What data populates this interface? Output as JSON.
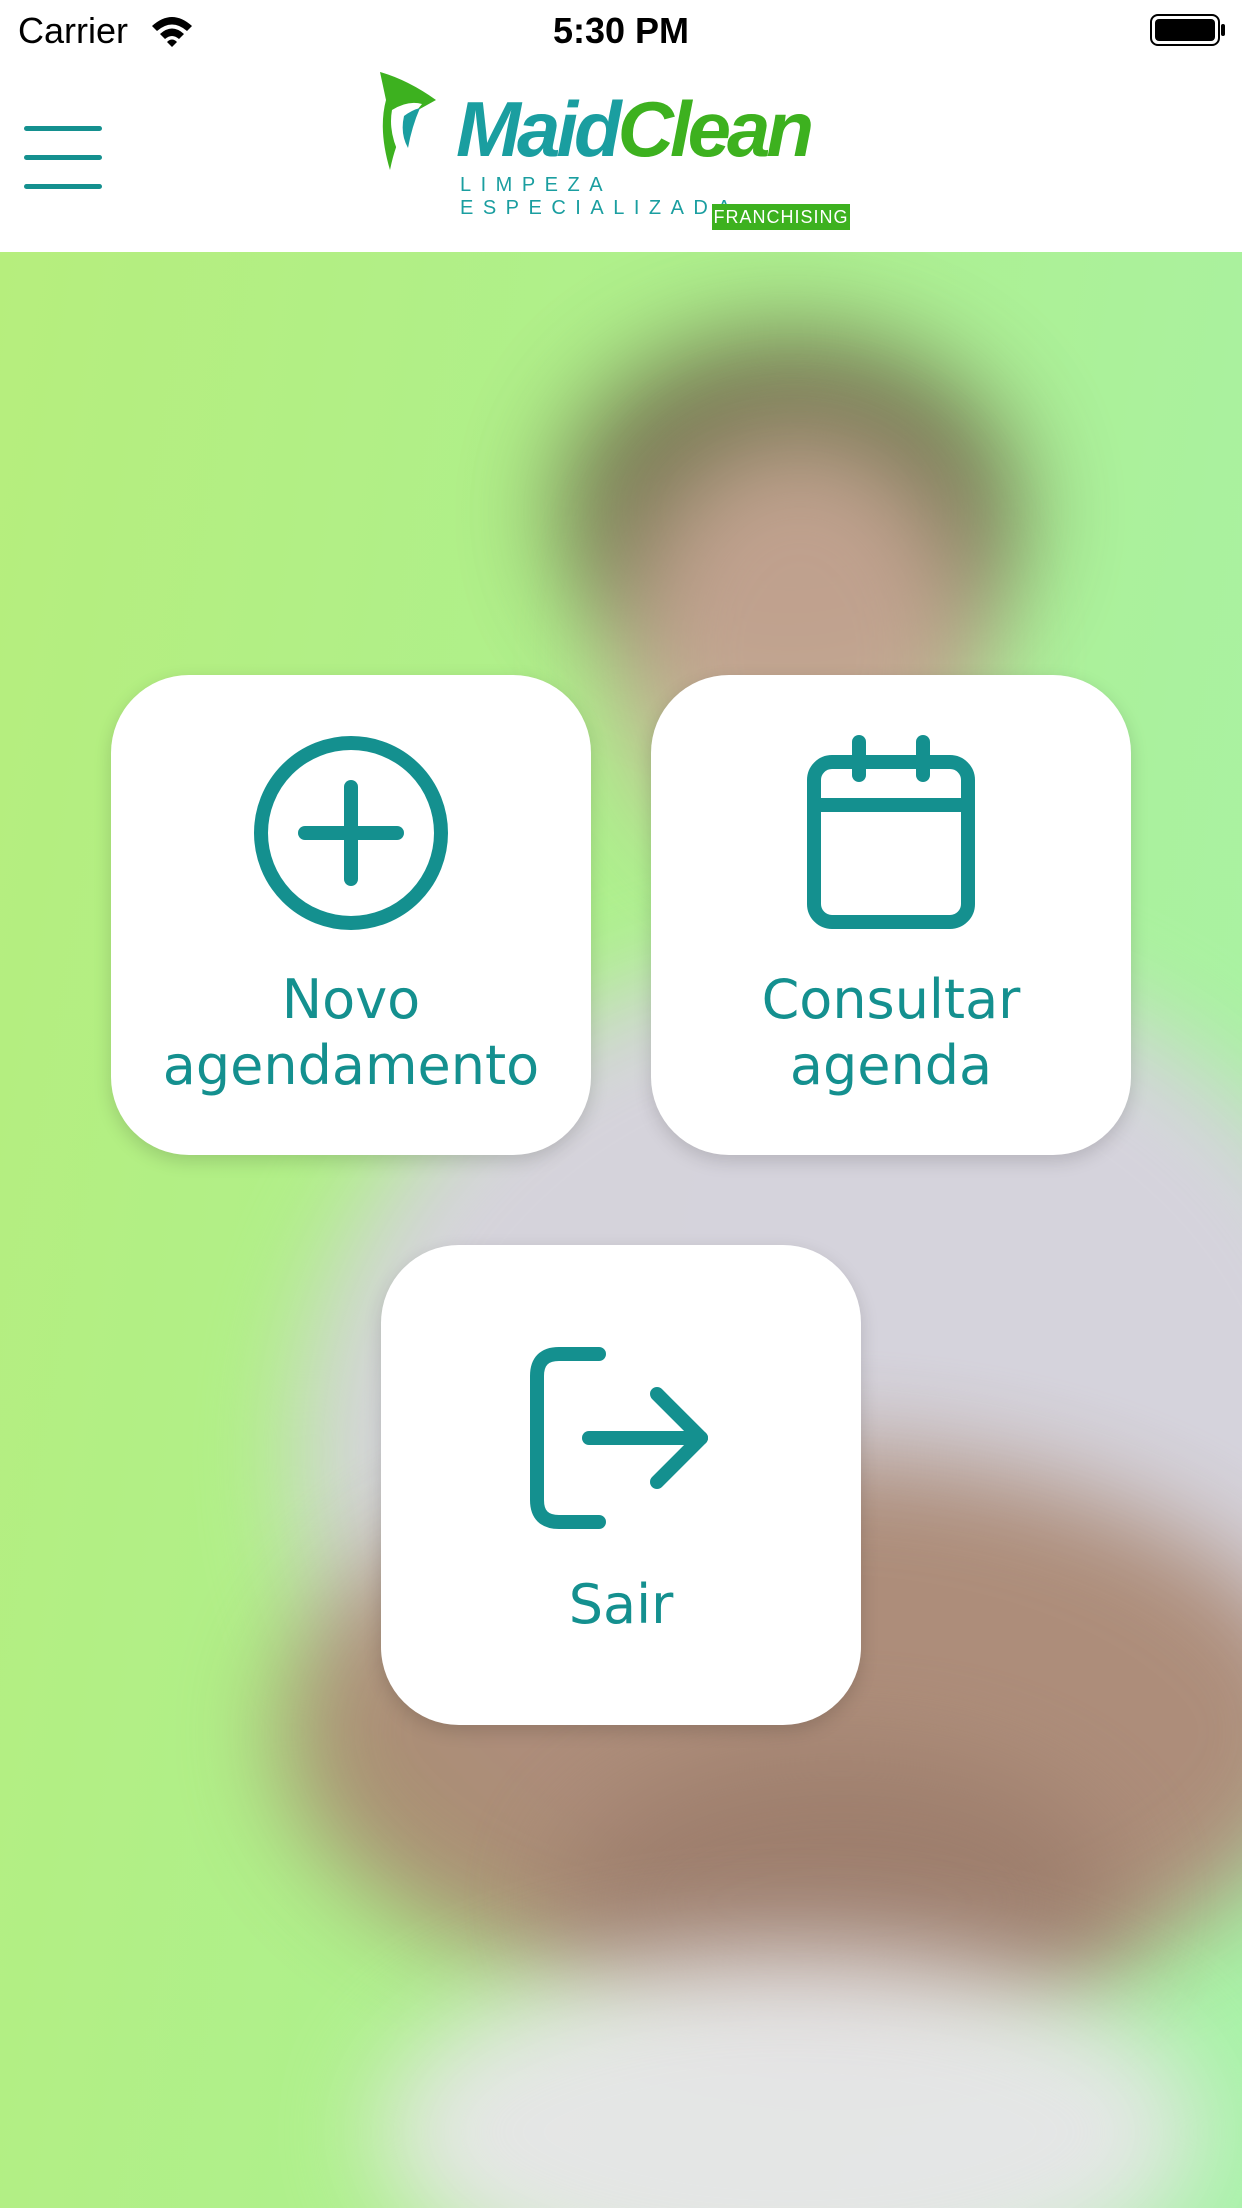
{
  "status_bar": {
    "carrier": "Carrier",
    "time": "5:30 PM"
  },
  "header": {
    "logo": {
      "brand_part1": "Maid",
      "brand_part2": "Clean",
      "tagline": "LIMPEZA ESPECIALIZADA",
      "badge": "FRANCHISING"
    },
    "menu_icon": "hamburger-menu-icon"
  },
  "tiles": [
    {
      "label_line1": "Novo",
      "label_line2": "agendamento",
      "icon": "plus-circle-icon"
    },
    {
      "label_line1": "Consultar",
      "label_line2": "agenda",
      "icon": "calendar-icon"
    },
    {
      "label_line1": "Sair",
      "icon": "logout-icon"
    }
  ],
  "colors": {
    "accent": "#14908f",
    "brand_green": "#3db11f",
    "brand_teal": "#1a9ea0"
  }
}
